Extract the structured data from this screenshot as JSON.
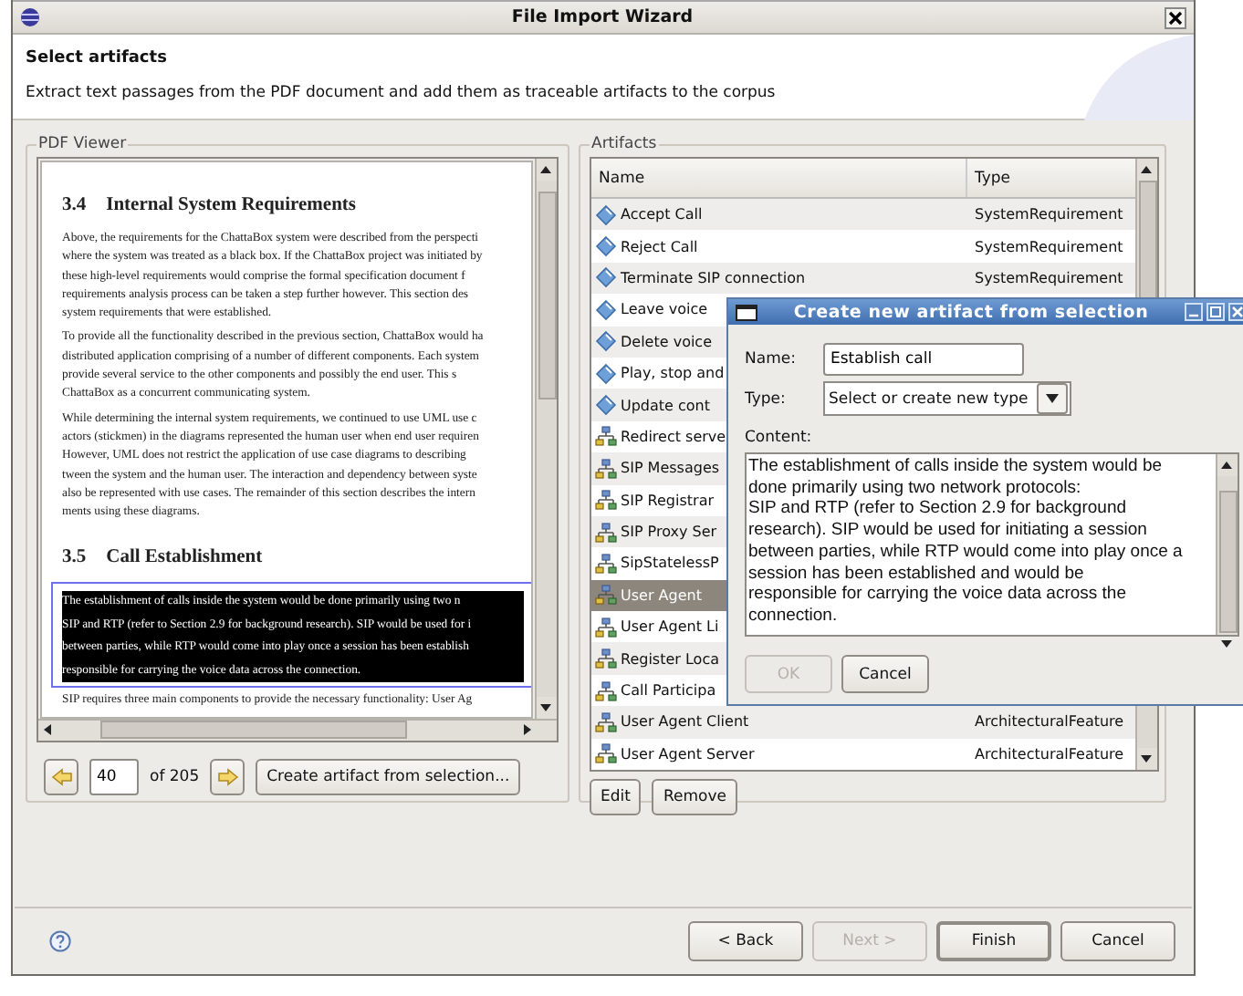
{
  "window": {
    "title": "File Import Wizard"
  },
  "header": {
    "title": "Select artifacts",
    "description": "Extract text passages from the PDF document and add them as traceable artifacts to the corpus"
  },
  "pdf_viewer": {
    "label": "PDF Viewer",
    "blocks": [
      {
        "kind": "heading",
        "number": "3.4",
        "title": "Internal System Requirements"
      },
      {
        "kind": "paragraph",
        "selected": false,
        "text": "Above, the requirements for the ChattaBox system were described from the perspecti\nwhere the system was treated as a black box. If the ChattaBox project was initiated by\nthese high-level requirements would comprise the formal specification document f\nrequirements analysis process can be taken a step further however. This section des\nsystem requirements that were established."
      },
      {
        "kind": "paragraph",
        "selected": false,
        "text": "To provide all the functionality described in the previous section, ChattaBox would ha\ndistributed application comprising of a number of different components. Each system\nprovide several service to the other components and possibly the end user. This s\nChattaBox as a concurrent communicating system."
      },
      {
        "kind": "paragraph",
        "selected": false,
        "text": "While determining the internal system requirements, we continued to use UML use c\nactors (stickmen) in the diagrams represented the human user when end user requiren\nHowever, UML does not restrict the application of use case diagrams to describing\ntween the system and the human user. The interaction and dependency between syste\nalso be represented with use cases. The remainder of this section describes the intern\nments using these diagrams."
      },
      {
        "kind": "heading",
        "number": "3.5",
        "title": "Call Establishment"
      },
      {
        "kind": "paragraph",
        "selected": true,
        "text": "The establishment of calls inside the system would be done primarily using two n\nSIP and RTP (refer to Section 2.9 for background research). SIP would be used for i\nbetween parties, while RTP would come into play once a session has been establish\nresponsible for carrying the voice data across the connection."
      },
      {
        "kind": "paragraph",
        "selected": false,
        "text": "SIP requires three main components to provide the necessary functionality: User Ag"
      }
    ],
    "page": "40",
    "page_count": "of 205",
    "create_button": "Create artifact from selection..."
  },
  "artifacts": {
    "label": "Artifacts",
    "columns": [
      "Name",
      "Type"
    ],
    "rows": [
      {
        "kind": "requirement",
        "name": "Accept Call",
        "type": "SystemRequirement",
        "selected": false
      },
      {
        "kind": "requirement",
        "name": "Reject Call",
        "type": "SystemRequirement",
        "selected": false
      },
      {
        "kind": "requirement",
        "name": "Terminate SIP connection",
        "type": "SystemRequirement",
        "selected": false
      },
      {
        "kind": "requirement",
        "name": "Leave voice",
        "selected": false
      },
      {
        "kind": "requirement",
        "name": "Delete voice",
        "selected": false
      },
      {
        "kind": "requirement",
        "name": "Play, stop and",
        "selected": false
      },
      {
        "kind": "requirement",
        "name": "Update cont",
        "selected": false
      },
      {
        "kind": "feature",
        "name": "Redirect serve",
        "selected": false
      },
      {
        "kind": "feature",
        "name": "SIP Messages",
        "selected": false
      },
      {
        "kind": "feature",
        "name": "SIP Registrar",
        "selected": false
      },
      {
        "kind": "feature",
        "name": "SIP Proxy Ser",
        "selected": false
      },
      {
        "kind": "feature",
        "name": "SipStatelessP",
        "selected": false
      },
      {
        "kind": "feature",
        "name": "User Agent",
        "selected": true
      },
      {
        "kind": "feature",
        "name": "User Agent Li",
        "selected": false
      },
      {
        "kind": "feature",
        "name": "Register Loca",
        "selected": false
      },
      {
        "kind": "feature",
        "name": "Call Participa",
        "selected": false
      },
      {
        "kind": "feature",
        "name": "User Agent Client",
        "type": "ArchitecturalFeature",
        "selected": false
      },
      {
        "kind": "feature",
        "name": "User Agent Server",
        "type": "ArchitecturalFeature",
        "selected": false
      }
    ],
    "buttons": [
      "Edit",
      "Remove"
    ]
  },
  "footer": {
    "buttons": [
      {
        "label": "< Back",
        "disabled": false,
        "default": false
      },
      {
        "label": "Next >",
        "disabled": true,
        "default": false
      },
      {
        "label": "Finish",
        "disabled": false,
        "default": true
      },
      {
        "label": "Cancel",
        "disabled": false,
        "default": false
      }
    ]
  },
  "dialog": {
    "title": "Create new artifact from selection",
    "name_label": "Name:",
    "name_value": "Establish call",
    "type_label": "Type:",
    "type_value": "Select or create new type",
    "content_label": "Content:",
    "content": "The establishment of calls inside the system would be\ndone primarily using two network protocols:\nSIP and RTP (refer to Section 2.9 for background\nresearch). SIP would be used for initiating a session\nbetween parties, while RTP would come into play once a\nsession has been established and would be\nresponsible for carrying the voice data across the\nconnection.",
    "buttons": [
      {
        "label": "OK",
        "disabled": true
      },
      {
        "label": "Cancel",
        "disabled": false
      }
    ]
  }
}
